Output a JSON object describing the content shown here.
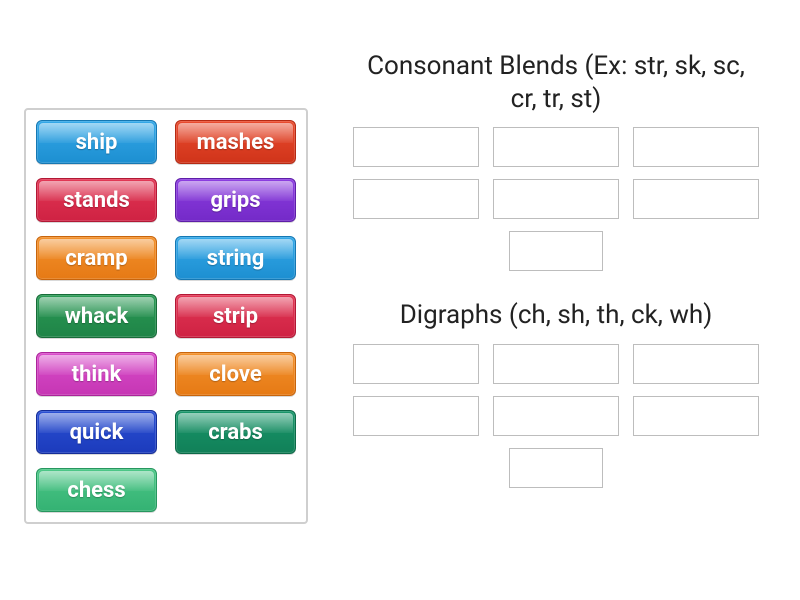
{
  "word_bank": {
    "tiles": [
      {
        "label": "ship",
        "color": "cyan"
      },
      {
        "label": "mashes",
        "color": "red"
      },
      {
        "label": "stands",
        "color": "crimson"
      },
      {
        "label": "grips",
        "color": "purple"
      },
      {
        "label": "cramp",
        "color": "orange"
      },
      {
        "label": "string",
        "color": "cyan"
      },
      {
        "label": "whack",
        "color": "green1"
      },
      {
        "label": "strip",
        "color": "crimson"
      },
      {
        "label": "think",
        "color": "magenta"
      },
      {
        "label": "clove",
        "color": "orange"
      },
      {
        "label": "quick",
        "color": "blue"
      },
      {
        "label": "crabs",
        "color": "green2"
      },
      {
        "label": "chess",
        "color": "mint"
      }
    ]
  },
  "categories": {
    "blends": {
      "title": "Consonant Blends (Ex: str, sk, sc, cr, tr, st)",
      "slot_count": 7
    },
    "digraphs": {
      "title": "Digraphs (ch, sh, th, ck, wh)",
      "slot_count": 7
    }
  },
  "colors": {
    "cyan": "#1d8fd1",
    "red": "#d0341a",
    "orange": "#e67a15",
    "purple": "#742ac8",
    "green1": "#1f8447",
    "crimson": "#cf2243",
    "magenta": "#c636b4",
    "blue": "#1c3bbc",
    "green2": "#118058",
    "mint": "#34b273"
  }
}
